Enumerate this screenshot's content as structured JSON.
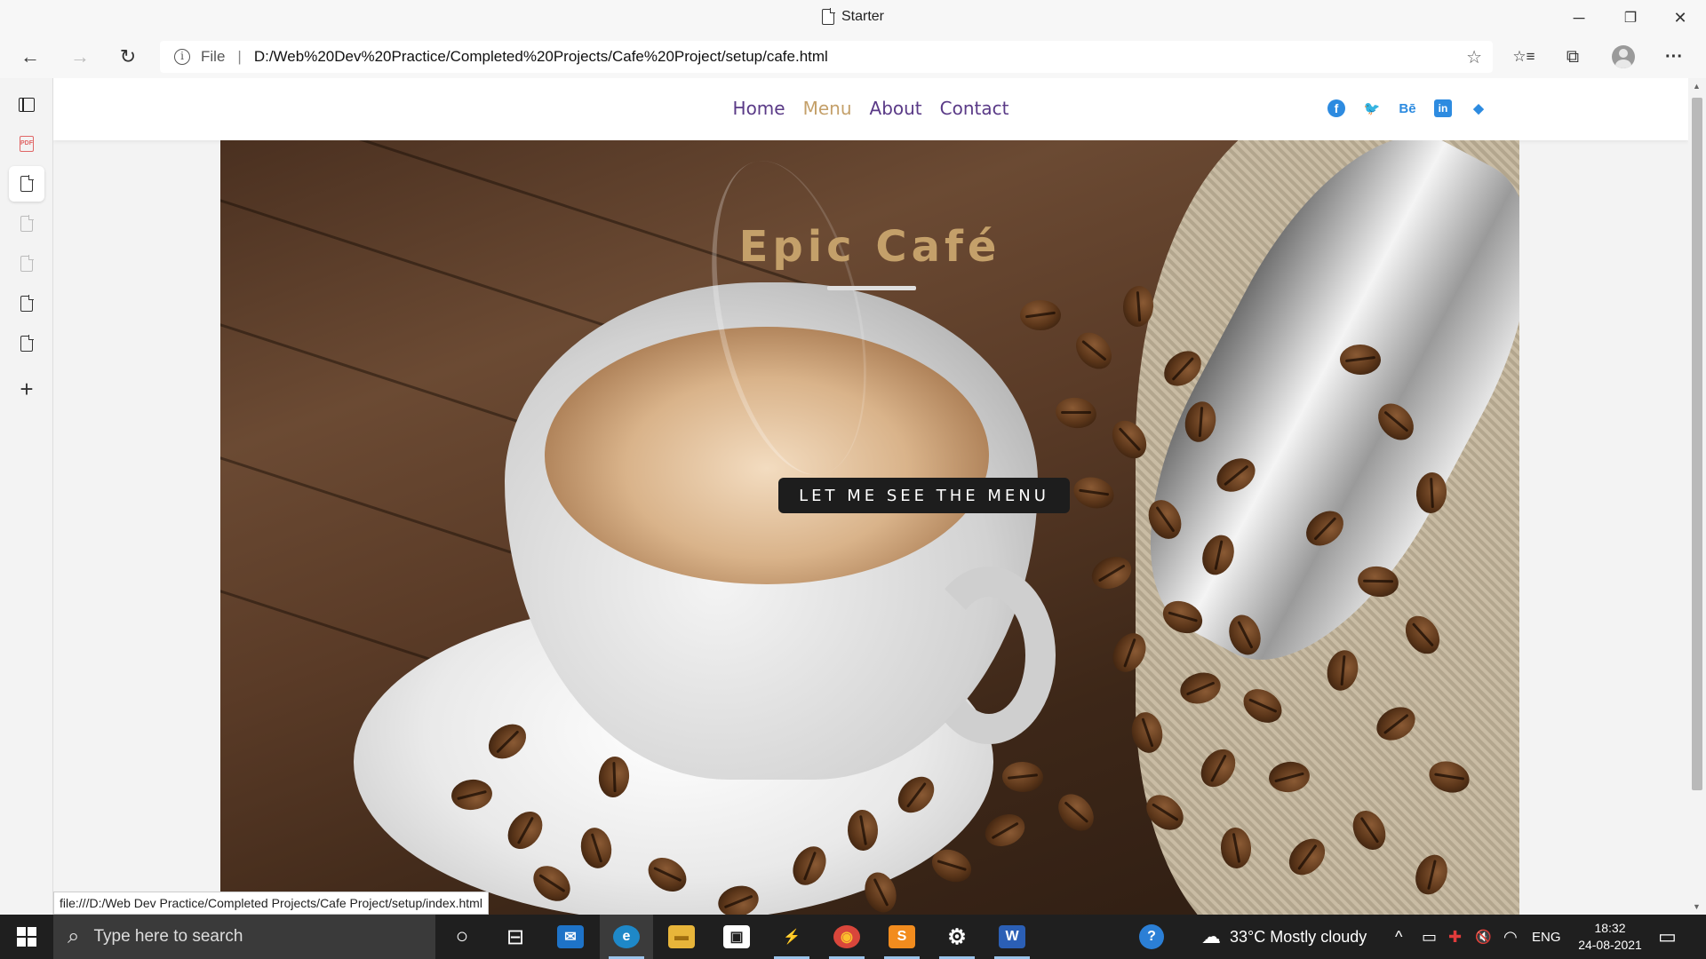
{
  "window": {
    "title": "Starter",
    "minimize_icon": "─",
    "restore_icon": "❐",
    "close_icon": "✕"
  },
  "browser": {
    "back_icon": "←",
    "forward_icon": "→",
    "refresh_icon": "↻",
    "info_icon": "i",
    "scheme": "File",
    "separator": "|",
    "url": "D:/Web%20Dev%20Practice/Completed%20Projects/Cafe%20Project/setup/cafe.html",
    "add_favorite_icon": "☆",
    "favorites_icon": "☆≡",
    "collections_icon": "⧉",
    "more_icon": "···"
  },
  "sidebar": {
    "add_tab_icon": "+",
    "pdf_label": "PDF"
  },
  "site": {
    "nav": [
      "Home",
      "Menu",
      "About",
      "Contact"
    ],
    "active_nav": "Menu",
    "social": {
      "facebook": "f",
      "twitter": "🐦",
      "behance": "Bē",
      "linkedin": "in",
      "dribbble": "◆"
    },
    "hero_title": "Epic Café",
    "cta": "LET ME SEE THE MENU"
  },
  "status_link": "file:///D:/Web Dev Practice/Completed Projects/Cafe Project/setup/index.html",
  "taskbar": {
    "search_placeholder": "Type here to search",
    "search_icon": "⌕",
    "cortana_icon": "○",
    "taskview_icon": "⊟",
    "mail_icon": "✉",
    "edge_icon": "e",
    "explorer_icon": "▬",
    "store_icon": "▣",
    "vscode_icon": "⚡",
    "chrome_icon": "◉",
    "sublime_icon": "S",
    "settings_icon": "⚙",
    "word_icon": "W",
    "help_icon": "?",
    "weather_icon": "☁",
    "weather": "33°C  Mostly cloudy",
    "tray_chevron": "^",
    "battery_icon": "▭",
    "volume_icon": "🔇",
    "wifi_icon": "◠",
    "language": "ENG",
    "time": "18:32",
    "date": "24-08-2021",
    "notification_icon": "▭"
  }
}
